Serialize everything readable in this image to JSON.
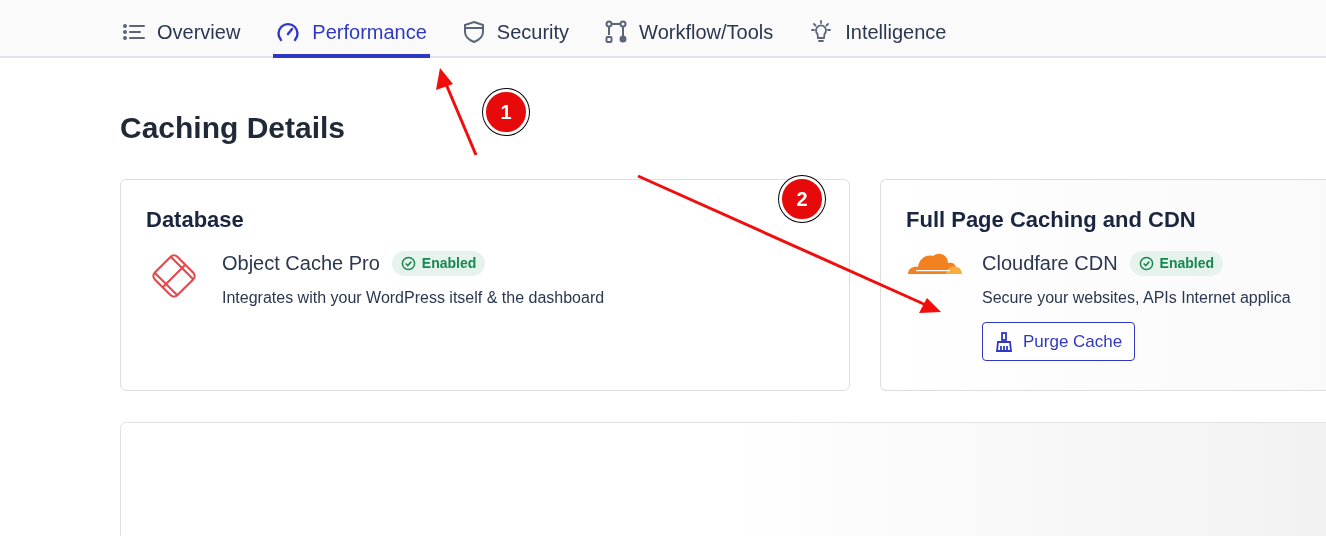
{
  "tabs": [
    {
      "label": "Overview",
      "selected": false
    },
    {
      "label": "Performance",
      "selected": true
    },
    {
      "label": "Security",
      "selected": false
    },
    {
      "label": "Workflow/Tools",
      "selected": false
    },
    {
      "label": "Intelligence",
      "selected": false
    }
  ],
  "heading": "Caching Details",
  "cards": [
    {
      "title": "Database",
      "name": "Object Cache Pro",
      "badge": "Enabled",
      "description": "Integrates with your WordPress itself & the dashboard"
    },
    {
      "title": "Full Page Caching and CDN",
      "name": "Cloudfare CDN",
      "badge": "Enabled",
      "description": "Secure your websites, APIs Internet applica",
      "button": "Purge Cache"
    }
  ],
  "annotations": [
    {
      "label": "1"
    },
    {
      "label": "2"
    }
  ]
}
